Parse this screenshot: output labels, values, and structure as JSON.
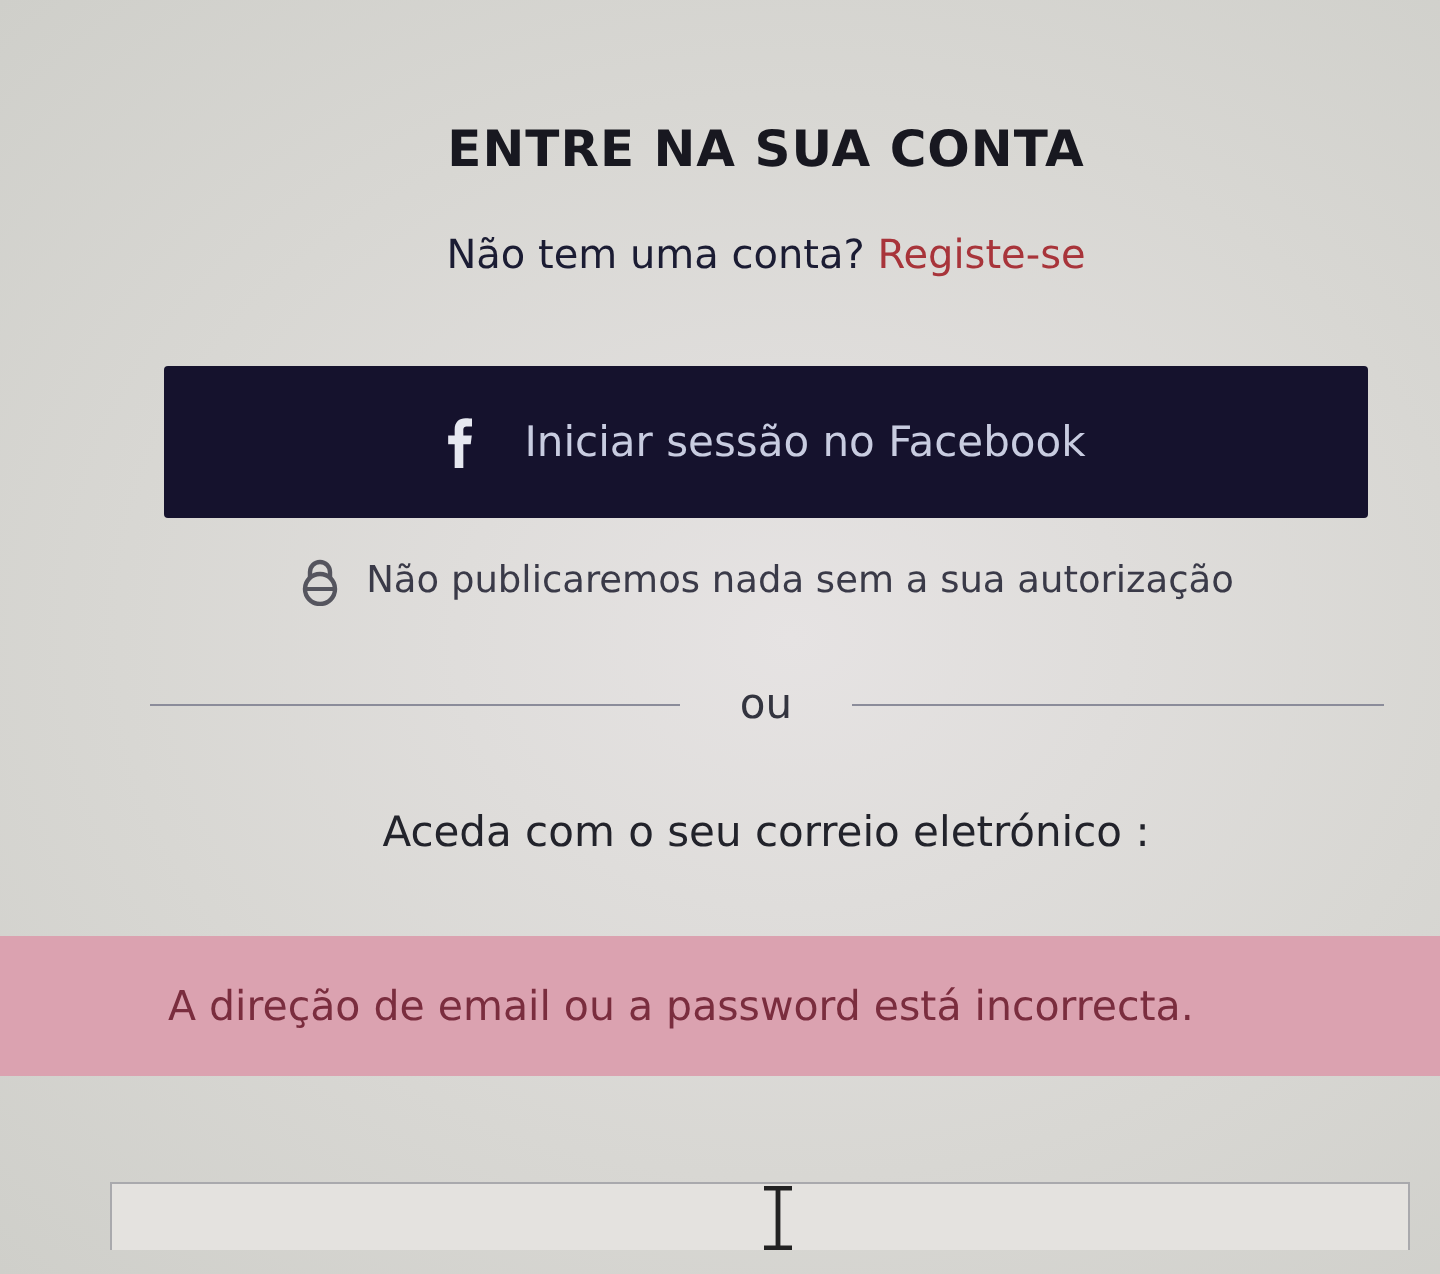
{
  "heading": "ENTRE NA SUA CONTA",
  "signup_prompt": {
    "text": "Não tem uma conta?",
    "link": "Registe-se"
  },
  "facebook_button": {
    "label": "Iniciar sessão no Facebook"
  },
  "privacy_note": "Não publicaremos nada sem a sua autorização",
  "divider": {
    "label": "ou"
  },
  "email_prompt": "Aceda com o seu correio eletrónico :",
  "error_banner": {
    "message": "A direção de email ou a password está incorrecta."
  }
}
